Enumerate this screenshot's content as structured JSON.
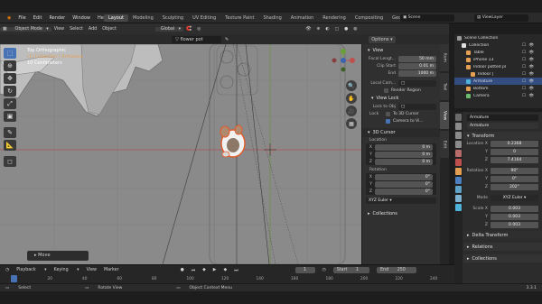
{
  "topbar": {
    "menus": [
      "File",
      "Edit",
      "Render",
      "Window",
      "Help"
    ],
    "workspaces": [
      "Layout",
      "Modeling",
      "Sculpting",
      "UV Editing",
      "Texture Paint",
      "Shading",
      "Animation",
      "Rendering",
      "Compositing",
      "Geometry Nod"
    ],
    "active_workspace": "Layout",
    "scene": "Scene",
    "view_layer": "ViewLayer"
  },
  "viewport_header": {
    "mode": "Object Mode",
    "menus": [
      "View",
      "Select",
      "Add",
      "Object"
    ],
    "orientation": "Global",
    "options": "Options",
    "object_field": "flower pot"
  },
  "viewport": {
    "overlay_title": "Top Orthographic",
    "overlay_collection": "(1) Collection | Armature",
    "overlay_scale": "10 Centimeters",
    "last_op": "Move"
  },
  "npanel": {
    "view_section": "View",
    "focal_label": "Focal Lengt...",
    "focal_value": "50 mm",
    "clip_start_label": "Clip Start",
    "clip_start_value": "0.01 m",
    "clip_end_label": "End",
    "clip_end_value": "1000 m",
    "local_camera_label": "Local Cam...",
    "render_region": "Render Region",
    "view_lock_section": "View Lock",
    "lock_obj_label": "Lock to Obj",
    "lock_label": "Lock",
    "to_3d_cursor": "To 3D Cursor",
    "camera_to_view": "Camera to Vi...",
    "cursor_section": "3D Cursor",
    "location_label": "Location",
    "x_label": "X",
    "y_label": "Y",
    "z_label": "Z",
    "loc_x": "0 m",
    "loc_y": "0 m",
    "loc_z": "0 m",
    "rotation_label": "Rotation",
    "rot_x": "0°",
    "rot_y": "0°",
    "rot_z": "0°",
    "rot_mode": "XYZ Euler",
    "collections_section": "Collections"
  },
  "sidetabs": [
    "Item",
    "Tool",
    "View",
    "Edit"
  ],
  "outliner": {
    "rows": [
      {
        "name": "Scene Collection",
        "indent": 0,
        "color": "#9a9a9a"
      },
      {
        "name": "Collection",
        "indent": 1,
        "color": "#e0e0e0"
      },
      {
        "name": "Table",
        "indent": 2,
        "color": "#e59f52"
      },
      {
        "name": "iPhone 13",
        "indent": 2,
        "color": "#e59f52"
      },
      {
        "name": "Indoor potted pl",
        "indent": 2,
        "color": "#e59f52"
      },
      {
        "name": "Indoor |",
        "indent": 3,
        "color": "#e59f52"
      },
      {
        "name": "Armature",
        "indent": 2,
        "color": "#4fb2d8"
      },
      {
        "name": "Bottom",
        "indent": 2,
        "color": "#e59f52"
      },
      {
        "name": "Camera",
        "indent": 2,
        "color": "#6dbb6d"
      }
    ],
    "selected_row": "Armature"
  },
  "properties": {
    "object_name": "Armature",
    "data_name": "Armature",
    "transform_section": "Transform",
    "location_label": "Location X",
    "loc_x": "0.2368",
    "loc_y": "0",
    "loc_z": "7.4164",
    "rotation_label": "Rotation X",
    "rot_x": "90°",
    "rot_y": "0°",
    "rot_z": "202°",
    "mode_label": "Mode",
    "mode_value": "XYZ Euler",
    "scale_label": "Scale X",
    "scale_x": "0.003",
    "scale_y": "0.003",
    "scale_z": "0.003",
    "y_label": "Y",
    "z_label": "Z",
    "delta_section": "Delta Transform",
    "relations_section": "Relations",
    "collections_section": "Collections"
  },
  "timeline": {
    "menus": [
      "Playback",
      "Keying",
      "View",
      "Marker"
    ],
    "current_frame": "1",
    "start_label": "Start",
    "start_value": "1",
    "end_label": "End",
    "end_value": "250",
    "ruler": [
      "1",
      "20",
      "40",
      "60",
      "80",
      "100",
      "120",
      "140",
      "160",
      "180",
      "200",
      "220",
      "240"
    ]
  },
  "status": {
    "select": "Select",
    "rotate": "Rotate View",
    "context": "Object Context Menu",
    "version": "3.3.1"
  }
}
